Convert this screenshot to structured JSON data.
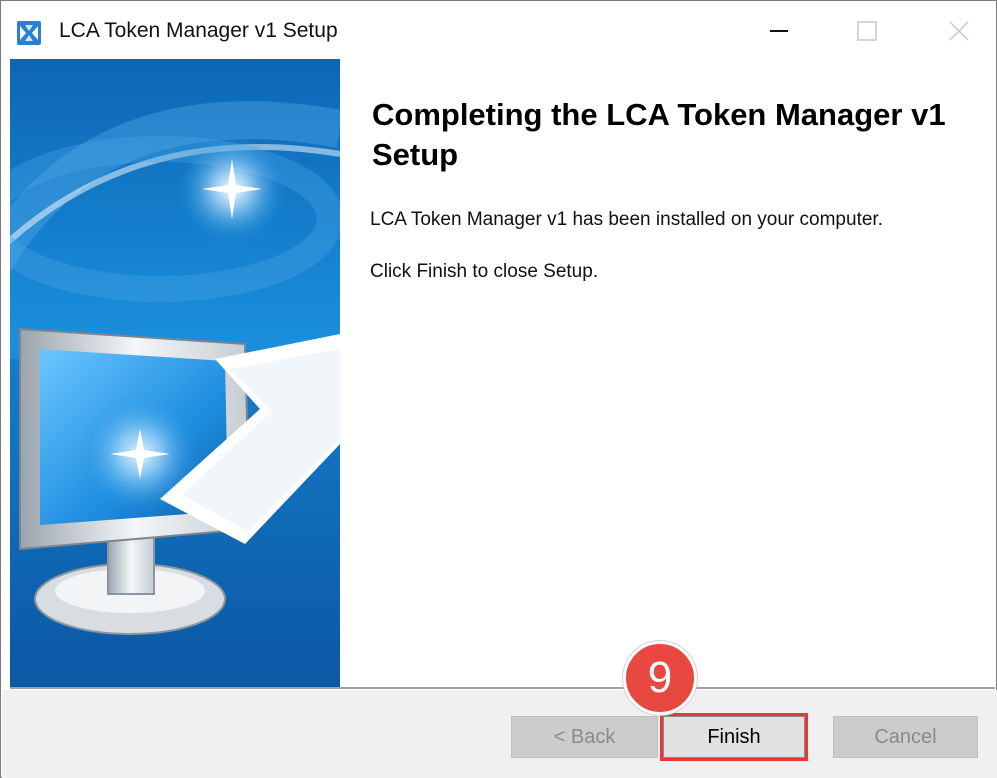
{
  "window": {
    "title": "LCA Token Manager v1 Setup",
    "icon": "installer-icon"
  },
  "title_controls": {
    "minimize_icon": "minimize-icon",
    "maximize_icon": "maximize-icon",
    "close_icon": "close-icon"
  },
  "content": {
    "heading": "Completing the LCA Token Manager v1 Setup",
    "message_installed": "LCA Token Manager v1 has been installed on your computer.",
    "message_finish": "Click Finish to close Setup."
  },
  "buttons": {
    "back": "< Back",
    "finish": "Finish",
    "cancel": "Cancel"
  },
  "annotation": {
    "step_number": "9",
    "highlight_color": "#e53935"
  },
  "colors": {
    "banner_blue": "#1f8fd8",
    "badge_red": "#e8483f"
  }
}
